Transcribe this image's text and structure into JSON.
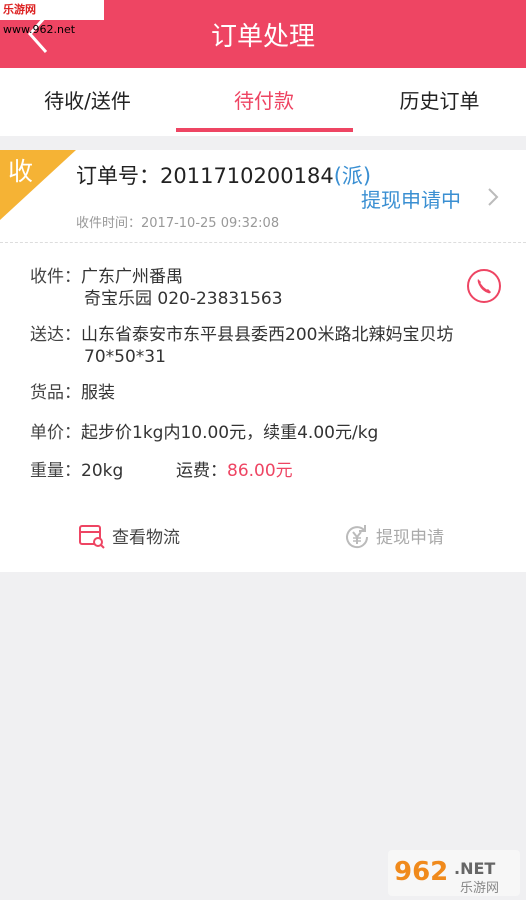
{
  "watermark_top": {
    "brand": "乐游网",
    "url": " www.962.net"
  },
  "header": {
    "title": "订单处理",
    "back_icon": "chevron-left-icon"
  },
  "tabs": [
    {
      "label": "待收/送件",
      "active": false
    },
    {
      "label": "待付款",
      "active": true
    },
    {
      "label": "历史订单",
      "active": false
    }
  ],
  "order": {
    "corner_label": "收",
    "order_no_label": "订单号：",
    "order_no": "2011710200184",
    "type_tag": "(派)",
    "receive_time_label": "收件时间：",
    "receive_time": "2017-10-25 09:32:08",
    "status": "提现申请中",
    "receive_label": "收件：",
    "receive_line1": "广东广州番禺",
    "receive_line2": "奇宝乐园 020-23831563",
    "deliver_label": "送达：",
    "deliver_line1": "山东省泰安市东平县县委西200米路北辣妈宝贝坊",
    "deliver_line2": "70*50*31",
    "goods_label": "货品：",
    "goods": "服装",
    "price_label": "单价：",
    "price": "起步价1kg内10.00元，续重4.00元/kg",
    "weight_label": "重量：",
    "weight": "20kg",
    "fee_label": "运费：",
    "fee": "86.00元"
  },
  "actions": {
    "logistics": "查看物流",
    "withdraw": "提现申请"
  },
  "colors": {
    "accent": "#ee4563",
    "link": "#3a8fd2",
    "corner": "#f5b335"
  },
  "watermark_bottom": {
    "number": "962",
    "suffix": ".NET",
    "site": "乐游网"
  }
}
